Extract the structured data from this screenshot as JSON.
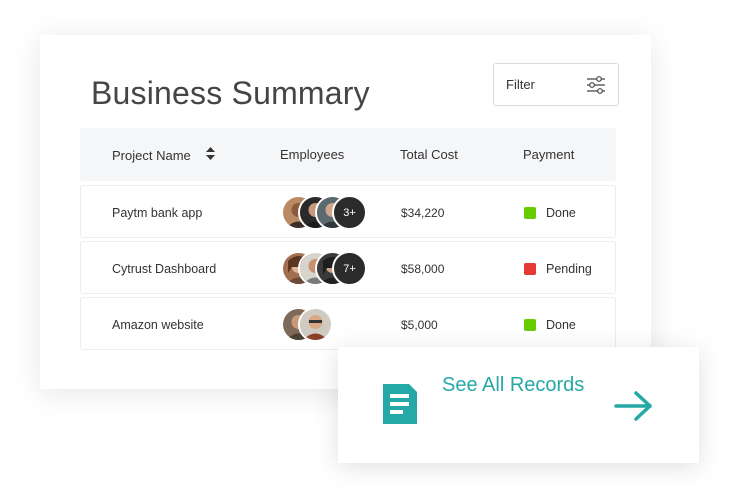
{
  "card": {
    "title": "Business Summary",
    "filter_label": "Filter"
  },
  "table": {
    "headers": {
      "project": "Project Name",
      "employees": "Employees",
      "cost": "Total Cost",
      "payment": "Payment"
    },
    "rows": [
      {
        "name": "Paytm bank app",
        "more": "3+",
        "cost": "$34,220",
        "payment": "Done",
        "status_color": "#66cc00"
      },
      {
        "name": "Cytrust Dashboard",
        "more": "7+",
        "cost": "$58,000",
        "payment": "Pending",
        "status_color": "#e53935"
      },
      {
        "name": "Amazon website",
        "cost": "$5,000",
        "payment": "Done",
        "status_color": "#66cc00"
      }
    ]
  },
  "records": {
    "label": "See All Records"
  },
  "colors": {
    "accent": "#24a9a6",
    "done": "#66cc00",
    "pending": "#e53935"
  },
  "icons": {
    "filter": "sliders-icon",
    "sort": "sort-icon",
    "records": "document-icon",
    "arrow": "arrow-right-icon"
  }
}
